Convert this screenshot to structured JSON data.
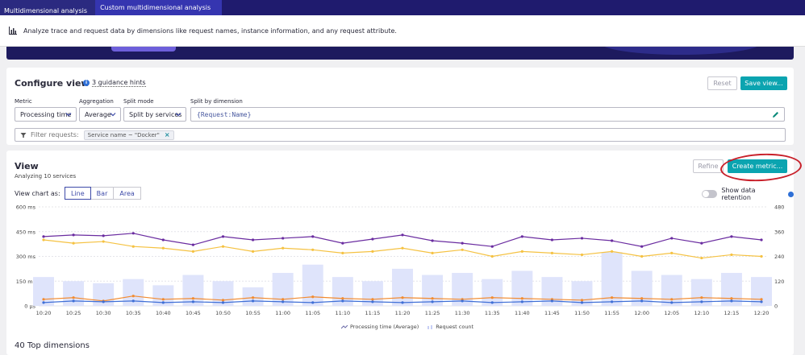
{
  "breadcrumb": {
    "items": [
      "Multidimensional analysis",
      "Custom multidimensional analysis"
    ]
  },
  "info_bar": {
    "text": "Analyze trace and request data by dimensions like request names, instance information, and any request attribute."
  },
  "configure": {
    "title": "Configure view",
    "hints_label": "3 guidance hints",
    "reset_label": "Reset",
    "save_label": "Save view...",
    "metric": {
      "label": "Metric",
      "value": "Processing time"
    },
    "aggregation": {
      "label": "Aggregation",
      "value": "Average"
    },
    "split_mode": {
      "label": "Split mode",
      "value": "Split by services"
    },
    "split_dimension": {
      "label": "Split by dimension",
      "value": "{Request:Name}"
    },
    "filter": {
      "placeholder": "Filter requests:",
      "chip": "Service name ~ \"Docker\""
    }
  },
  "view": {
    "title": "View",
    "subtitle": "Analyzing 10 services",
    "refine_label": "Refine",
    "create_metric_label": "Create metric...",
    "chart_as_label": "View chart as:",
    "chart_types": [
      "Line",
      "Bar",
      "Area"
    ],
    "active_chart_type": "Line",
    "data_retention_label": "Show data retention",
    "top_dimensions": "40 Top dimensions"
  },
  "colors": {
    "nav_bg": "#1f1b6e",
    "accent_teal": "#0ba4b0",
    "annotation_red": "#c8202a",
    "request_bars": "#dfe4fb",
    "series_purple": "#6a2ca0",
    "series_yellow": "#f5c242",
    "series_orange": "#f28b30",
    "series_blue": "#3f6fd6",
    "series_teal": "#29b7c0"
  },
  "chart_data": {
    "type": "line",
    "x": [
      "10:20",
      "10:25",
      "10:30",
      "10:35",
      "10:40",
      "10:45",
      "10:50",
      "10:55",
      "11:00",
      "11:05",
      "11:10",
      "11:15",
      "11:20",
      "11:25",
      "11:30",
      "11:35",
      "11:40",
      "11:45",
      "11:50",
      "11:55",
      "12:00",
      "12:05",
      "12:10",
      "12:15",
      "12:20"
    ],
    "y_left": {
      "ticks": [
        "0 µs",
        "150 ms",
        "300 ms",
        "450 ms",
        "600 ms"
      ],
      "range": [
        0,
        600
      ],
      "unit": "ms"
    },
    "y_right": {
      "ticks": [
        "0",
        "120",
        "240",
        "360",
        "480"
      ],
      "range": [
        0,
        480
      ]
    },
    "series": [
      {
        "name": "Processing time (Average)",
        "axis": "left",
        "color": "#6a2ca0",
        "values": [
          420,
          430,
          425,
          440,
          400,
          370,
          420,
          400,
          410,
          420,
          380,
          405,
          430,
          395,
          380,
          360,
          420,
          400,
          410,
          395,
          360,
          410,
          380,
          420,
          400
        ]
      },
      {
        "name": "Processing time (Average)",
        "axis": "left",
        "color": "#f5c242",
        "values": [
          400,
          380,
          390,
          360,
          350,
          330,
          360,
          330,
          350,
          340,
          320,
          330,
          350,
          320,
          340,
          300,
          330,
          320,
          310,
          330,
          300,
          320,
          290,
          310,
          300
        ]
      },
      {
        "name": "Processing time (Average)",
        "axis": "left",
        "color": "#f28b30",
        "values": [
          40,
          50,
          30,
          60,
          40,
          45,
          35,
          50,
          40,
          55,
          45,
          40,
          50,
          45,
          40,
          50,
          45,
          40,
          35,
          50,
          45,
          40,
          50,
          45,
          40
        ]
      },
      {
        "name": "Processing time (Average)",
        "axis": "left",
        "color": "#3f6fd6",
        "values": [
          20,
          30,
          25,
          30,
          20,
          25,
          20,
          30,
          25,
          20,
          30,
          25,
          20,
          25,
          30,
          20,
          25,
          30,
          20,
          25,
          30,
          20,
          25,
          30,
          25
        ]
      },
      {
        "name": "Request count",
        "axis": "right",
        "color": "#dfe4fb",
        "values": [
          140,
          120,
          110,
          130,
          100,
          150,
          120,
          90,
          160,
          200,
          140,
          120,
          180,
          150,
          160,
          130,
          170,
          140,
          120,
          260,
          170,
          150,
          130,
          160,
          140
        ]
      }
    ],
    "legend": [
      "Processing time (Average)",
      "Request count"
    ],
    "legend_position": "bottom",
    "grid": true
  }
}
